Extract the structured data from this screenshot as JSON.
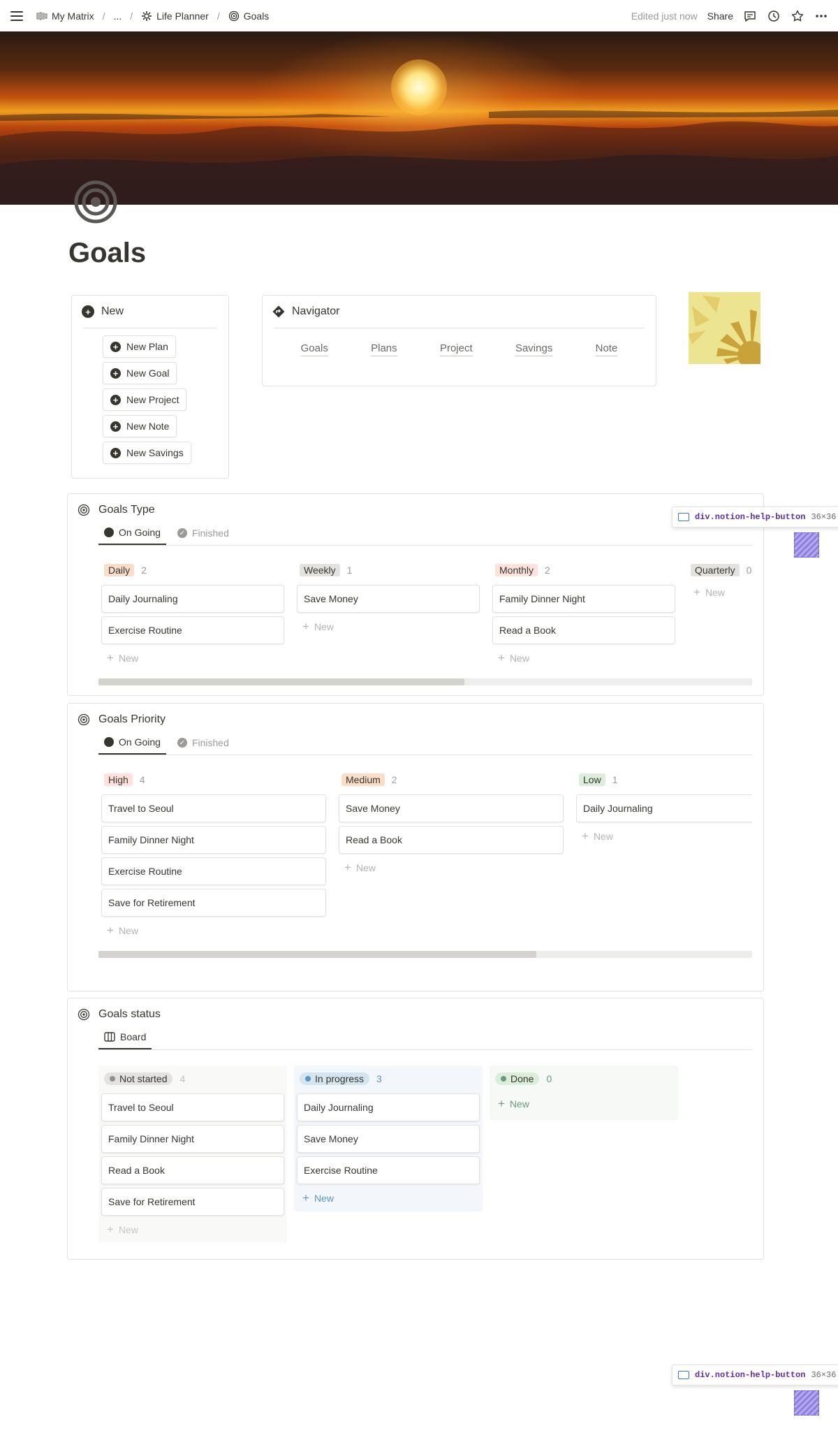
{
  "topbar": {
    "breadcrumbs": [
      "My Matrix",
      "...",
      "Life Planner",
      "Goals"
    ],
    "edited": "Edited just now",
    "share": "Share"
  },
  "page": {
    "title": "Goals"
  },
  "new_box": {
    "title": "New",
    "buttons": [
      "New Plan",
      "New Goal",
      "New Project",
      "New Note",
      "New Savings"
    ]
  },
  "navigator": {
    "title": "Navigator",
    "links": [
      "Goals",
      "Plans",
      "Project",
      "Savings",
      "Note"
    ]
  },
  "goals_type": {
    "title": "Goals Type",
    "tabs": [
      "On Going",
      "Finished"
    ],
    "columns": [
      {
        "label": "Daily",
        "count": "2",
        "cards": [
          "Daily Journaling",
          "Exercise Routine"
        ]
      },
      {
        "label": "Weekly",
        "count": "1",
        "cards": [
          "Save Money"
        ]
      },
      {
        "label": "Monthly",
        "count": "2",
        "cards": [
          "Family Dinner Night",
          "Read a Book"
        ]
      },
      {
        "label": "Quarterly",
        "count": "0",
        "cards": []
      }
    ],
    "scroll_fraction": 0.56
  },
  "goals_priority": {
    "title": "Goals Priority",
    "tabs": [
      "On Going",
      "Finished"
    ],
    "columns": [
      {
        "label": "High",
        "count": "4",
        "cards": [
          "Travel to Seoul",
          "Family Dinner Night",
          "Exercise Routine",
          "Save for Retirement"
        ]
      },
      {
        "label": "Medium",
        "count": "2",
        "cards": [
          "Save Money",
          "Read a Book"
        ]
      },
      {
        "label": "Low",
        "count": "1",
        "cards": [
          "Daily Journaling"
        ]
      }
    ],
    "scroll_fraction": 0.67
  },
  "goals_status": {
    "title": "Goals status",
    "tabs": [
      "Board"
    ],
    "columns": [
      {
        "label": "Not started",
        "count": "4",
        "cards": [
          "Travel to Seoul",
          "Family Dinner Night",
          "Read a Book",
          "Save for Retirement"
        ]
      },
      {
        "label": "In progress",
        "count": "3",
        "cards": [
          "Daily Journaling",
          "Save Money",
          "Exercise Routine"
        ]
      },
      {
        "label": "Done",
        "count": "0",
        "cards": []
      }
    ]
  },
  "new_label": "New",
  "help_overlay": {
    "name": "div.notion-help-button",
    "size": "36×36"
  },
  "colors": {
    "daily": "#fadec9",
    "weekly": "#e3e2e0",
    "monthly": "#ffe2dd",
    "quarterly": "#e3e2e0",
    "high": "#ffe2dd",
    "medium": "#fadec9",
    "low": "#dbeddb",
    "not_started_bg": "#f9f9f8",
    "in_progress_bg": "#f3f7fb",
    "done_bg": "#f6f9f6"
  }
}
